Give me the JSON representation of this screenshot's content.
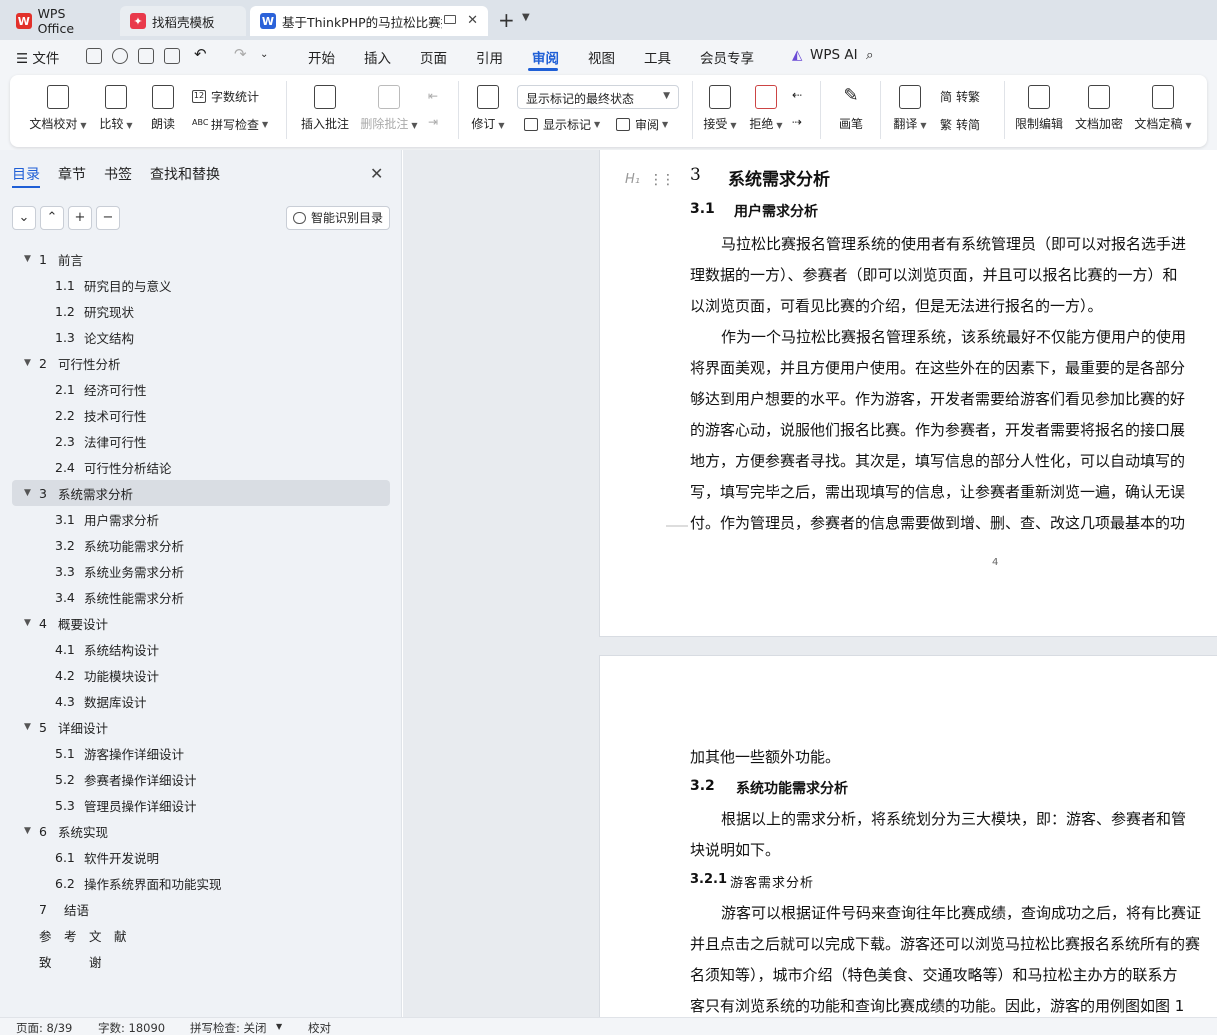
{
  "tabs": {
    "wps": "WPS Office",
    "dao": "找稻壳模板",
    "doc": "基于ThinkPHP的马拉松比赛报"
  },
  "menu": {
    "file": "文件",
    "items": [
      "开始",
      "插入",
      "页面",
      "引用",
      "审阅",
      "视图",
      "工具",
      "会员专享"
    ],
    "ai": "WPS AI"
  },
  "ribbon": {
    "doc_proof": "文档校对",
    "compare": "比较",
    "read_aloud": "朗读",
    "word_count": "字数统计",
    "spell_check": "拼写检查",
    "insert_comment": "插入批注",
    "delete_comment": "删除批注",
    "revise": "修订",
    "markup_state": "显示标记的最终状态",
    "show_markup": "显示标记",
    "review": "审阅",
    "accept": "接受",
    "reject": "拒绝",
    "pen": "画笔",
    "translate": "翻译",
    "trad": "转繁",
    "simp": "转简",
    "restrict_edit": "限制编辑",
    "doc_encrypt": "文档加密",
    "doc_finalize": "文档定稿"
  },
  "nav": {
    "tabs": [
      "目录",
      "章节",
      "书签",
      "查找和替换"
    ],
    "smart": "智能识别目录",
    "toc": [
      {
        "num": "1",
        "text": "前言",
        "level": 1
      },
      {
        "num": "1.1",
        "text": "研究目的与意义",
        "level": 2
      },
      {
        "num": "1.2",
        "text": "研究现状",
        "level": 2
      },
      {
        "num": "1.3",
        "text": "论文结构",
        "level": 2
      },
      {
        "num": "2",
        "text": "可行性分析",
        "level": 1
      },
      {
        "num": "2.1",
        "text": "经济可行性",
        "level": 2
      },
      {
        "num": "2.2",
        "text": "技术可行性",
        "level": 2
      },
      {
        "num": "2.3",
        "text": "法律可行性",
        "level": 2
      },
      {
        "num": "2.4",
        "text": "可行性分析结论",
        "level": 2
      },
      {
        "num": "3",
        "text": "系统需求分析",
        "level": 1
      },
      {
        "num": "3.1",
        "text": "用户需求分析",
        "level": 2
      },
      {
        "num": "3.2",
        "text": "系统功能需求分析",
        "level": 2
      },
      {
        "num": "3.3",
        "text": "系统业务需求分析",
        "level": 2
      },
      {
        "num": "3.4",
        "text": "系统性能需求分析",
        "level": 2
      },
      {
        "num": "4",
        "text": "概要设计",
        "level": 1
      },
      {
        "num": "4.1",
        "text": "系统结构设计",
        "level": 2
      },
      {
        "num": "4.2",
        "text": "功能模块设计",
        "level": 2
      },
      {
        "num": "4.3",
        "text": "数据库设计",
        "level": 2
      },
      {
        "num": "5",
        "text": "详细设计",
        "level": 1
      },
      {
        "num": "5.1",
        "text": "游客操作详细设计",
        "level": 2
      },
      {
        "num": "5.2",
        "text": "参赛者操作详细设计",
        "level": 2
      },
      {
        "num": "5.3",
        "text": "管理员操作详细设计",
        "level": 2
      },
      {
        "num": "6",
        "text": "系统实现",
        "level": 1
      },
      {
        "num": "6.1",
        "text": "软件开发说明",
        "level": 2
      },
      {
        "num": "6.2",
        "text": "操作系统界面和功能实现",
        "level": 2
      },
      {
        "num": "7",
        "text": "结语",
        "level": 0
      },
      {
        "num": "",
        "text": "参　考　文　献",
        "level": 0
      },
      {
        "num": "",
        "text": "致　　　谢",
        "level": 0
      }
    ]
  },
  "doc": {
    "h1_num": "3",
    "h1_text": "系统需求分析",
    "h2a_num": "3.1",
    "h2a_text": "用户需求分析",
    "p1": [
      "马拉松比赛报名管理系统的使用者有系统管理员（即可以对报名选手进",
      "理数据的一方）、参赛者（即可以浏览页面，并且可以报名比赛的一方）和",
      "以浏览页面，可看见比赛的介绍，但是无法进行报名的一方）。"
    ],
    "p2": [
      "作为一个马拉松比赛报名管理系统，该系统最好不仅能方便用户的使用",
      "将界面美观，并且方便用户使用。在这些外在的因素下，最重要的是各部分",
      "够达到用户想要的水平。作为游客，开发者需要给游客们看见参加比赛的好",
      "的游客心动，说服他们报名比赛。作为参赛者，开发者需要将报名的接口展",
      "地方，方便参赛者寻找。其次是，填写信息的部分人性化，可以自动填写的",
      "写，填写完毕之后，需出现填写的信息，让参赛者重新浏览一遍，确认无误",
      "付。作为管理员，参赛者的信息需要做到增、删、查、改这几项最基本的功"
    ],
    "page_num": "4",
    "p3": "加其他一些额外功能。",
    "h2b_num": "3.2",
    "h2b_text": "系统功能需求分析",
    "p4": [
      "根据以上的需求分析，将系统划分为三大模块，即：游客、参赛者和管",
      "块说明如下。"
    ],
    "h3_num": "3.2.1",
    "h3_text": "游客需求分析",
    "p5": [
      "游客可以根据证件号码来查询往年比赛成绩，查询成功之后，将有比赛证",
      "并且点击之后就可以完成下载。游客还可以浏览马拉松比赛报名系统所有的赛",
      "名须知等），城市介绍（特色美食、交通攻略等）和马拉松主办方的联系方",
      "客只有浏览系统的功能和查询比赛成绩的功能。因此，游客的用例图如图 1"
    ]
  },
  "status": {
    "page": "页面: 8/39",
    "words": "字数: 18090",
    "spell": "拼写检查: 关闭",
    "proof": "校对"
  },
  "colors": {
    "accent": "#1f5fd6",
    "panel": "#eff2f6",
    "selected": "#d9dde3"
  }
}
